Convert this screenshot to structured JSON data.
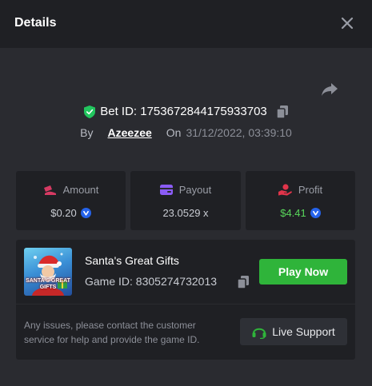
{
  "header": {
    "title": "Details"
  },
  "bet": {
    "id_label": "Bet ID: 1753672844175933703",
    "by_label": "By",
    "username": "Azeezee",
    "on_label": "On",
    "datetime": "31/12/2022, 03:39:10"
  },
  "stats": [
    {
      "label": "Amount",
      "value": "$0.20",
      "icon": "amount-icon",
      "currency_icon": "coin-icon"
    },
    {
      "label": "Payout",
      "value": "23.0529 x",
      "icon": "wallet-icon"
    },
    {
      "label": "Profit",
      "value": "$4.41",
      "icon": "profit-hand-icon",
      "currency_icon": "coin-icon"
    }
  ],
  "game": {
    "name": "Santa's Great Gifts",
    "id_label": "Game ID: 8305274732013",
    "thumb_text": "SANTA'S GREAT GIFTS",
    "play_label": "Play Now"
  },
  "support": {
    "notice": "Any issues, please contact the customer service for help and provide the game ID.",
    "button_label": "Live Support"
  },
  "colors": {
    "accent_green": "#2fb43a",
    "profit_green": "#59d65b",
    "icon_pink": "#d63a63",
    "icon_purple": "#8b5cf6",
    "icon_red": "#e0344a",
    "shield_green": "#22c55e"
  }
}
